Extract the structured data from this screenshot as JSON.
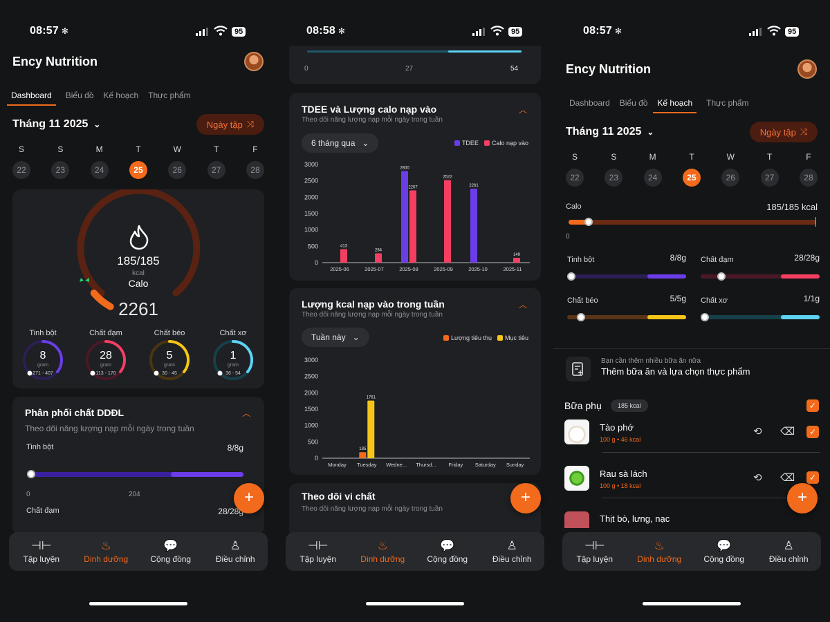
{
  "status": {
    "times": [
      "08:57",
      "08:58",
      "08:57"
    ],
    "battery": "95"
  },
  "app_title": "Ency Nutrition",
  "tabs": [
    "Dashboard",
    "Biểu đồ",
    "Kế hoạch",
    "Thực phẩm"
  ],
  "month_label": "Tháng 11 2025",
  "ngay_tap_label": "Ngày tập",
  "week": [
    {
      "dow": "S",
      "date": "22"
    },
    {
      "dow": "S",
      "date": "23"
    },
    {
      "dow": "M",
      "date": "24"
    },
    {
      "dow": "T",
      "date": "25"
    },
    {
      "dow": "W",
      "date": "26"
    },
    {
      "dow": "T",
      "date": "27"
    },
    {
      "dow": "F",
      "date": "28"
    }
  ],
  "dashboard": {
    "gauge_value": "185/185",
    "gauge_unit": "kcal",
    "gauge_label": "Calo",
    "gauge_tdee": "2261",
    "gauge_progress": 0.082,
    "macros": [
      {
        "name": "Tinh bột",
        "value": "8",
        "unit": "gram",
        "range": "271 - 407",
        "color": "#6a3de8",
        "track": "#2b1f55"
      },
      {
        "name": "Chất đạm",
        "value": "28",
        "unit": "gram",
        "range": "113 - 170",
        "color": "#f43f63",
        "track": "#4a1826"
      },
      {
        "name": "Chất béo",
        "value": "5",
        "unit": "gram",
        "range": "30 - 45",
        "color": "#f5c518",
        "track": "#4a3510"
      },
      {
        "name": "Chất xơ",
        "value": "1",
        "unit": "gram",
        "range": "36 - 54",
        "color": "#5dd3f3",
        "track": "#16404a"
      }
    ],
    "distribution_title": "Phân phối chất DDĐL",
    "distribution_sub": "Theo dõi năng lượng nạp mỗi ngày trong tuần",
    "tinh_bot_label": "Tinh bột",
    "tinh_bot_value": "8/8g",
    "tinh_bot_ticks": [
      "0",
      "204"
    ],
    "chat_dam_label": "Chất đạm",
    "chat_dam_value": "28/28g"
  },
  "charts_screen": {
    "top_ticks": [
      "0",
      "27",
      "54"
    ],
    "tdee_title": "TDEE và Lượng calo nạp vào",
    "tdee_sub": "Theo dõi năng lượng nạp mỗi ngày trong tuần",
    "tdee_filter": "6 tháng qua",
    "weekly_title": "Lượng kcal nạp vào trong tuần",
    "weekly_sub": "Theo dõi năng lượng nạp mỗi ngày trong tuần",
    "weekly_filter": "Tuần này",
    "micro_title": "Theo dõi vi chất",
    "micro_sub": "Theo dõi năng lượng nạp mỗi ngày trong tuần"
  },
  "chart_data": [
    {
      "type": "bar",
      "title": "TDEE và Lượng calo nạp vào",
      "categories": [
        "2025-06",
        "2025-07",
        "2025-08",
        "2025-09",
        "2025-10",
        "2025-11"
      ],
      "series": [
        {
          "name": "TDEE",
          "color": "#6a3de8",
          "values": [
            null,
            null,
            2800,
            null,
            2261,
            null
          ]
        },
        {
          "name": "Calo nạp vào",
          "color": "#f43f63",
          "values": [
            413,
            284,
            2207,
            2522,
            null,
            149
          ]
        }
      ],
      "yticks": [
        "0",
        "500",
        "1000",
        "1500",
        "2000",
        "2500",
        "3000"
      ],
      "ylim": [
        0,
        3000
      ]
    },
    {
      "type": "bar",
      "title": "Lượng kcal nạp vào trong tuần",
      "categories": [
        "Monday",
        "Tuesday",
        "Wedne...",
        "Thursd...",
        "Friday",
        "Saturday",
        "Sunday"
      ],
      "series": [
        {
          "name": "Lượng tiêu thụ",
          "color": "#f26a1b",
          "values": [
            null,
            185,
            null,
            null,
            null,
            null,
            null
          ]
        },
        {
          "name": "Mục tiêu",
          "color": "#f5c518",
          "values": [
            null,
            1761,
            null,
            null,
            null,
            null,
            null
          ]
        }
      ],
      "yticks": [
        "0",
        "500",
        "1000",
        "1500",
        "2000",
        "2500",
        "3000"
      ],
      "ylim": [
        0,
        3000
      ]
    }
  ],
  "plan": {
    "calo_label": "Calo",
    "calo_value": "185/185 kcal",
    "calo_zero": "0",
    "macros": [
      {
        "name": "Tinh bột",
        "value": "8/8g",
        "color": "#6a3de8",
        "track": "#2b1f55"
      },
      {
        "name": "Chất đạm",
        "value": "28/28g",
        "color": "#f43f63",
        "track": "#4a1826"
      },
      {
        "name": "Chất béo",
        "value": "5/5g",
        "color": "#f5c518",
        "track": "#5a3518"
      },
      {
        "name": "Chất xơ",
        "value": "1/1g",
        "color": "#5dd3f3",
        "track": "#16404a"
      }
    ],
    "add_hint": "Bạn cần thêm nhiều bữa ăn nữa",
    "add_action": "Thêm bữa ăn và lựa chọn thực phẩm",
    "meal_title": "Bữa phụ",
    "meal_kcal": "185 kcal",
    "foods": [
      {
        "name": "Tào phớ",
        "meta": "100 g • 46 kcal"
      },
      {
        "name": "Rau sà lách",
        "meta": "100 g • 18 kcal"
      },
      {
        "name": "Thịt bò, lưng, nạc",
        "meta": ""
      }
    ]
  },
  "nav": [
    "Tập luyện",
    "Dinh dưỡng",
    "Cộng đồng",
    "Điều chỉnh"
  ],
  "icons": {
    "nav": [
      "dumbbell-icon",
      "nutrition-drops-icon",
      "chat-icon",
      "person-icon"
    ]
  }
}
